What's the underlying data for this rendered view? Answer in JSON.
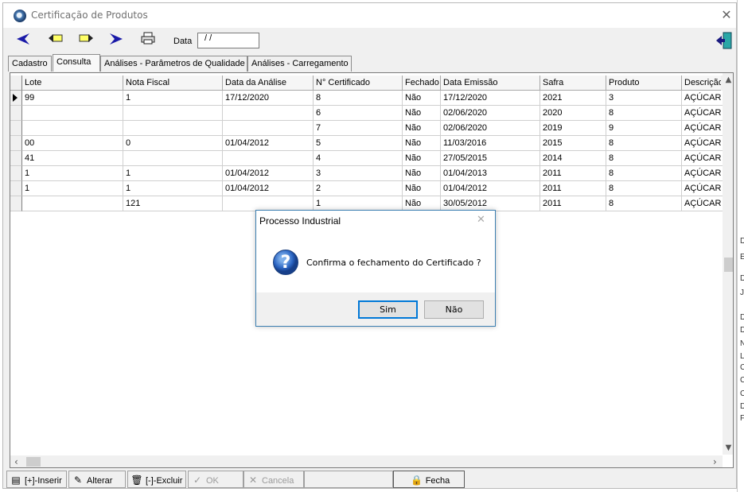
{
  "window": {
    "title": "Certificação de Produtos",
    "close_glyph": "✕"
  },
  "toolbar": {
    "date_label": "Data",
    "date_value": " / /",
    "buttons": [
      "first-icon",
      "prev-icon",
      "next-icon",
      "last-icon",
      "print-icon",
      "exit-door-icon"
    ]
  },
  "tabs": [
    {
      "label": "Cadastro"
    },
    {
      "label": "Consulta"
    },
    {
      "label": "Análises - Parâmetros de Qualidade"
    },
    {
      "label": "Análises - Carregamento"
    }
  ],
  "grid": {
    "columns": [
      "Lote",
      "Nota Fiscal",
      "Data da Análise",
      "N° Certificado",
      "Fechado",
      "Data Emissão",
      "Safra",
      "Produto",
      "Descrição"
    ],
    "rows": [
      [
        "99",
        "1",
        "17/12/2020",
        "8",
        "Não",
        "17/12/2020",
        "2021",
        "3",
        "AÇÚCAR T"
      ],
      [
        "",
        "",
        "",
        "6",
        "Não",
        "02/06/2020",
        "2020",
        "8",
        "AÇÚCAR T"
      ],
      [
        "",
        "",
        "",
        "7",
        "Não",
        "02/06/2020",
        "2019",
        "9",
        "AÇÚCAR T"
      ],
      [
        "00",
        "0",
        "01/04/2012",
        "5",
        "Não",
        "11/03/2016",
        "2015",
        "8",
        "AÇÚCAR T"
      ],
      [
        "41",
        "",
        "",
        "4",
        "Não",
        "27/05/2015",
        "2014",
        "8",
        "AÇÚCAR T"
      ],
      [
        "1",
        "1",
        "01/04/2012",
        "3",
        "Não",
        "01/04/2013",
        "2011",
        "8",
        "AÇÚCAR T"
      ],
      [
        "1",
        "1",
        "01/04/2012",
        "2",
        "Não",
        "01/04/2012",
        "2011",
        "8",
        "AÇÚCAR T"
      ],
      [
        "",
        "121",
        "",
        "1",
        "Não",
        "30/05/2012",
        "2011",
        "8",
        "AÇÚCAR T"
      ]
    ],
    "current_row": 0
  },
  "bottom_buttons": [
    {
      "label": "[+]-Inserir",
      "icon": "insert-icon",
      "enabled": true
    },
    {
      "label": "Alterar",
      "icon": "edit-icon",
      "enabled": true
    },
    {
      "label": "[-]-Excluir",
      "icon": "trash-icon",
      "enabled": true
    },
    {
      "label": "OK",
      "icon": "check-icon",
      "enabled": false
    },
    {
      "label": "Cancela",
      "icon": "cancel-icon",
      "enabled": false
    },
    {
      "label": "Fecha",
      "icon": "lock-icon",
      "enabled": true
    }
  ],
  "dialog": {
    "title": "Processo Industrial",
    "message": "Confirma o fechamento do Certificado ?",
    "icon": "question-icon",
    "yes_label": "Sim",
    "no_label": "Não"
  },
  "background_window_fragments": [
    "D",
    "E",
    "D",
    "JI",
    "D",
    "D",
    "N",
    "L",
    "C",
    "C",
    "C",
    "D",
    "F"
  ]
}
